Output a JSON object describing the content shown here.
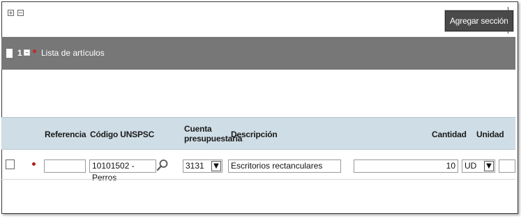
{
  "toolbar": {
    "expand_symbol": "+",
    "collapse_symbol": "−",
    "add_section_label": "Agregar sección"
  },
  "section": {
    "number": "1",
    "collapse_symbol": "−",
    "title": "Lista de artículos"
  },
  "table": {
    "columns": {
      "referencia": "Referencia",
      "codigo": "Código UNSPSC",
      "cuenta_line1": "Cuenta",
      "cuenta_line2": "presupuestaria",
      "descripcion": "Descripción",
      "cantidad": "Cantidad",
      "unidad": "Unidad"
    },
    "rows": [
      {
        "referencia": "",
        "codigo": "10101502 - Perros",
        "cuenta": "3131",
        "descripcion": "Escritorios rectanculares",
        "cantidad": "10",
        "unidad": "UD"
      }
    ]
  },
  "icons": {
    "search": "search-icon",
    "dropdown": "chevron-down-icon",
    "status": "red-dot-icon"
  },
  "colors": {
    "section_bar": "#777777",
    "table_header": "#cfdde6",
    "button_bg": "#4a4a4a",
    "status_dot": "#c22a2a"
  }
}
